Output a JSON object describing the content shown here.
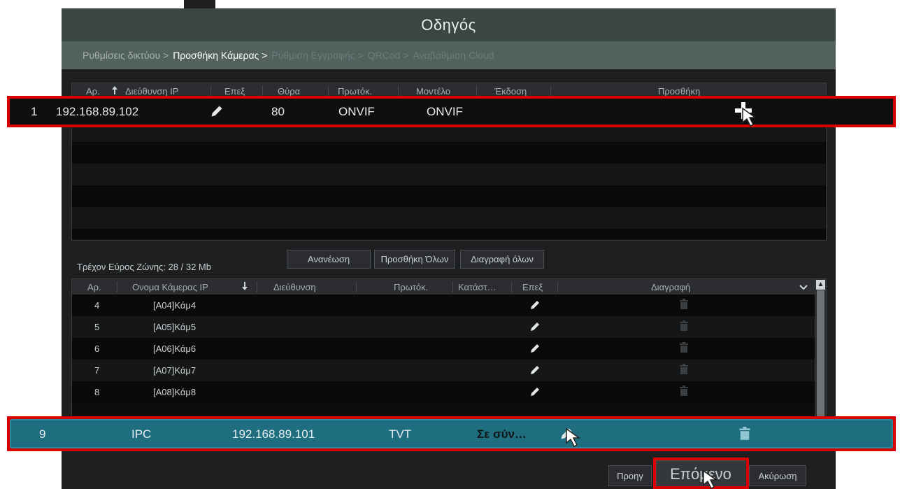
{
  "dialog": {
    "title": "Οδηγός",
    "steps": [
      {
        "label": "Ρυθμίσεις δικτύου >",
        "state": "done"
      },
      {
        "label": "Προσθήκη Κάμερας >",
        "state": "active"
      },
      {
        "label": "Ρύθμιση Εγγραφής >",
        "state": "future"
      },
      {
        "label": "QRCod >",
        "state": "future"
      },
      {
        "label": "Αναβάθμιση Cloud",
        "state": "future"
      }
    ]
  },
  "search_table": {
    "headers": {
      "no": "Αρ.",
      "ip": "Διεύθυνση IP",
      "edit": "Επεξ",
      "port": "Θύρα",
      "protocol": "Πρωτόκ.",
      "model": "Μοντέλο",
      "version": "Έκδοση",
      "add": "Προσθήκη"
    },
    "sort_icon": "arrow-up-icon",
    "rows": [
      {
        "no": "1",
        "ip": "192.168.89.102",
        "port": "80",
        "protocol": "ONVIF",
        "model": "ONVIF",
        "add_icon": "plus-icon"
      }
    ]
  },
  "bandwidth_label": "Τρέχον Εύρος Ζώνης: 28 / 32 Mb",
  "buttons": {
    "refresh": "Ανανέωση",
    "add_all": "Προσθήκη Όλων",
    "delete_all": "Διαγραφή όλων",
    "previous": "Προηγ",
    "next": "Επόμενο",
    "cancel": "Ακύρωση"
  },
  "added_table": {
    "headers": {
      "no": "Αρ.",
      "camera_name": "Ονομα Κάμερας IP",
      "address": "Διεύθυνση",
      "protocol": "Πρωτόκ.",
      "status": "Κατάστ…",
      "edit": "Επεξ",
      "delete": "Διαγραφή"
    },
    "sort_icon": "arrow-down-icon",
    "rows": [
      {
        "no": "4",
        "name": "[A04]Κάμ4"
      },
      {
        "no": "5",
        "name": "[A05]Κάμ5"
      },
      {
        "no": "6",
        "name": "[A06]Κάμ6"
      },
      {
        "no": "7",
        "name": "[A07]Κάμ7"
      },
      {
        "no": "8",
        "name": "[A08]Κάμ8"
      }
    ],
    "selected_row": {
      "no": "9",
      "name": "IPC",
      "address": "192.168.89.101",
      "protocol": "TVT",
      "status": "Σε σύν…"
    }
  },
  "colors": {
    "highlight": "#d90000",
    "selected_row": "#1e6e80",
    "title_bar": "#394644"
  }
}
